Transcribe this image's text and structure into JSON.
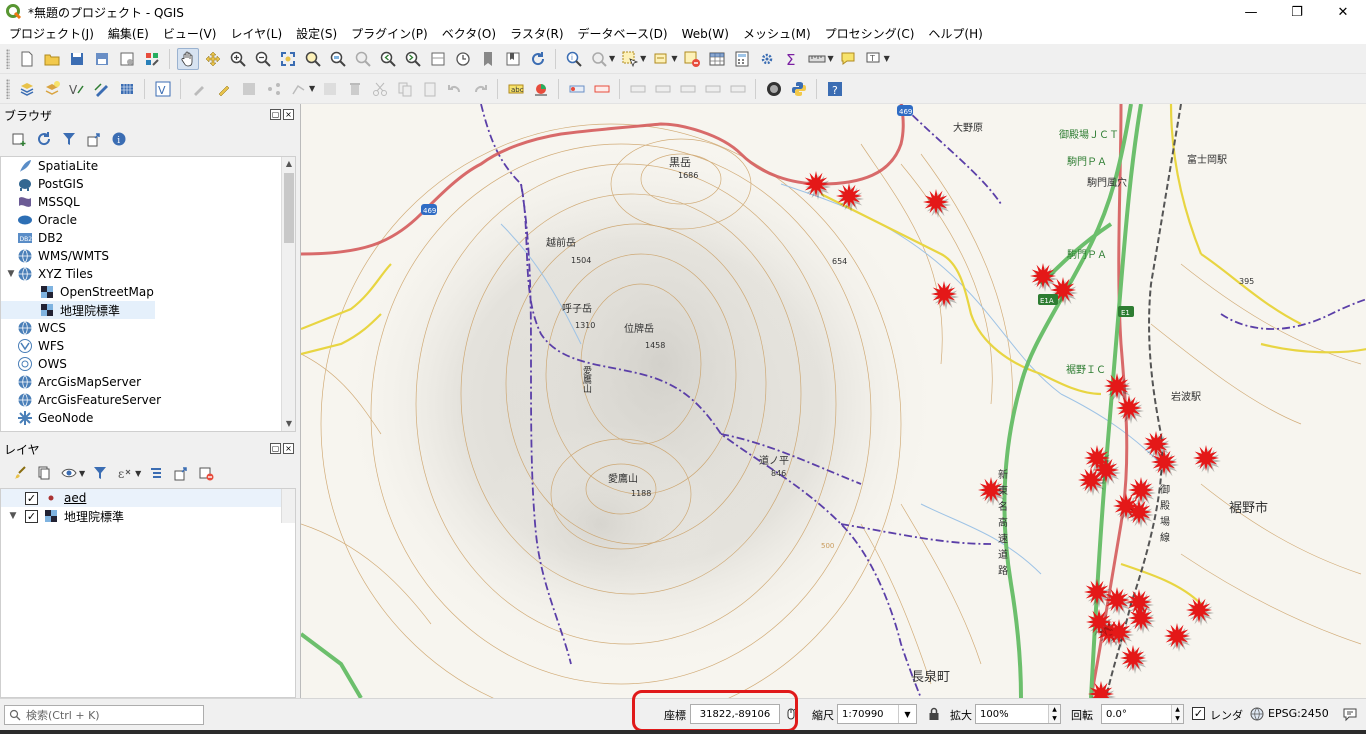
{
  "window": {
    "title": "*無題のプロジェクト - QGIS",
    "minimize": "—",
    "maximize": "❐",
    "close": "✕"
  },
  "menu": [
    "プロジェクト(J)",
    "編集(E)",
    "ビュー(V)",
    "レイヤ(L)",
    "設定(S)",
    "プラグイン(P)",
    "ベクタ(O)",
    "ラスタ(R)",
    "データベース(D)",
    "Web(W)",
    "メッシュ(M)",
    "プロセシング(C)",
    "ヘルプ(H)"
  ],
  "browser": {
    "title": "ブラウザ",
    "items": [
      {
        "label": "SpatiaLite",
        "icon": "feather-icon",
        "expander": ""
      },
      {
        "label": "PostGIS",
        "icon": "elephant-icon",
        "expander": ""
      },
      {
        "label": "MSSQL",
        "icon": "mssql-icon",
        "expander": ""
      },
      {
        "label": "Oracle",
        "icon": "oracle-icon",
        "expander": ""
      },
      {
        "label": "DB2",
        "icon": "db2-icon",
        "expander": ""
      },
      {
        "label": "WMS/WMTS",
        "icon": "globe-icon",
        "expander": ""
      },
      {
        "label": "XYZ Tiles",
        "icon": "globe-icon",
        "expander": "▼"
      },
      {
        "label": "OpenStreetMap",
        "icon": "tiles-icon",
        "expander": "",
        "indent": true
      },
      {
        "label": "地理院標準",
        "icon": "tiles-icon",
        "expander": "",
        "indent": true,
        "selected": true
      },
      {
        "label": "WCS",
        "icon": "globe-icon",
        "expander": ""
      },
      {
        "label": "WFS",
        "icon": "wfs-icon",
        "expander": ""
      },
      {
        "label": "OWS",
        "icon": "ows-icon",
        "expander": ""
      },
      {
        "label": "ArcGisMapServer",
        "icon": "globe-icon",
        "expander": ""
      },
      {
        "label": "ArcGisFeatureServer",
        "icon": "globe-icon",
        "expander": ""
      },
      {
        "label": "GeoNode",
        "icon": "geonode-icon",
        "expander": ""
      }
    ]
  },
  "layers": {
    "title": "レイヤ",
    "items": [
      {
        "label": "aed",
        "checked": "✓",
        "expander": ""
      },
      {
        "label": "地理院標準",
        "checked": "✓",
        "expander": "▼"
      }
    ]
  },
  "map": {
    "labels": {
      "kurodake": "黒岳",
      "kurodake_elev": "1686",
      "oonohara": "大野原",
      "gotemba_jct": "御殿場ＪＣＴ",
      "komakado_pa": "駒門ＰＡ",
      "fujioka": "富士岡駅",
      "komakado_fuketsu": "駒門風穴",
      "komakado_pa2": "駒門ＰＡ",
      "echizen": "越前岳",
      "echizen_elev": "1504",
      "elev654": "654",
      "elev395": "395",
      "yobikodake": "呼子岳",
      "yobikodake_elev": "1310",
      "ihaidake": "位牌岳",
      "ihaidake_elev": "1458",
      "susono_ic": "裾野ＩＣ",
      "iwanami": "岩波駅",
      "ashitaka": "愛鷹山",
      "ashitakayama": "愛鷹山",
      "ashitakayama_elev": "1188",
      "michinohira": "道ノ平",
      "michinohira_elev": "846",
      "shintomei": "新東名高速道路",
      "gotemba_line": "御殿場線",
      "susono_city": "裾野市",
      "nagaizumi": "長泉町",
      "route469a": "469",
      "route469b": "469",
      "e1a": "E1",
      "e1b": "E1A",
      "e1c": "E1",
      "seven": "500"
    }
  },
  "status": {
    "search_placeholder": "検索(Ctrl + K)",
    "coord_label": "座標",
    "coord_value": "31822,-89106",
    "scale_label": "縮尺",
    "scale_value": "1:70990",
    "magnifier_label": "拡大",
    "magnifier_value": "100%",
    "rotation_label": "回転",
    "rotation_value": "0.0°",
    "render_label": "レンダ",
    "render_checked": "✓",
    "crs": "EPSG:2450"
  },
  "colors": {
    "aed_marker": "#e41818",
    "highway": "#6cbf6c",
    "national_road": "#d45b5b",
    "prefectural_road": "#e8d542",
    "contour": "#c99b5c",
    "boundary": "#5b3fa8",
    "railway": "#555555"
  }
}
